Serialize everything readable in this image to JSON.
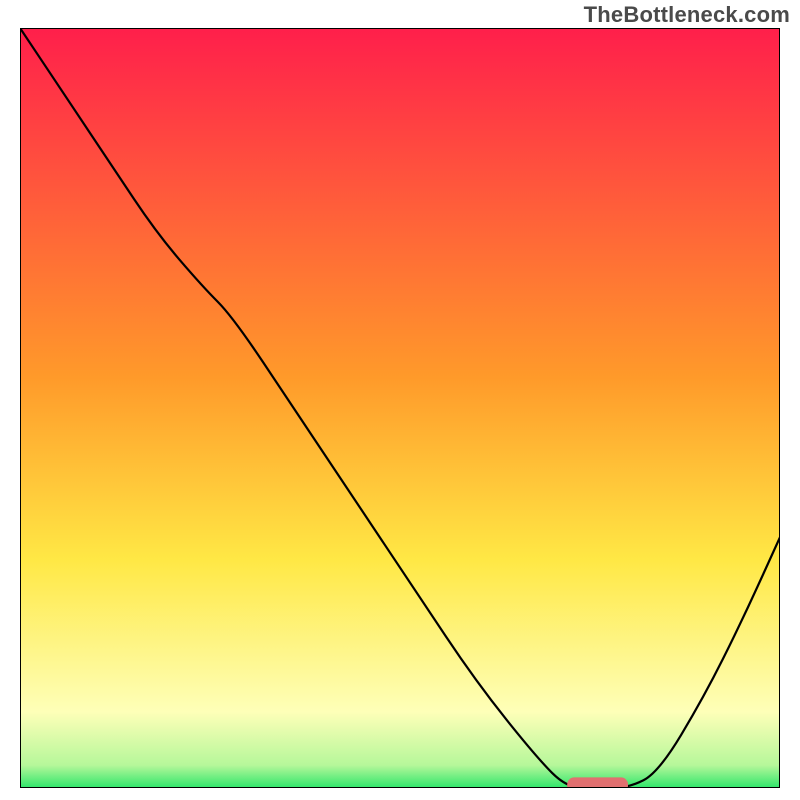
{
  "watermark": "TheBottleneck.com",
  "colors": {
    "gradient_top": "#ff1f4b",
    "gradient_mid1": "#ff9a2a",
    "gradient_mid2": "#ffe845",
    "gradient_pale": "#feffb8",
    "gradient_green": "#2ee66b",
    "curve": "#000000",
    "marker": "#e17070"
  },
  "chart_data": {
    "type": "line",
    "title": "",
    "xlabel": "",
    "ylabel": "",
    "xlim": [
      0,
      100
    ],
    "ylim": [
      0,
      100
    ],
    "grid": false,
    "series": [
      {
        "name": "bottleneck-curve",
        "x": [
          0,
          6,
          12,
          18,
          24,
          28,
          36,
          44,
          52,
          60,
          68,
          72,
          76,
          80,
          84,
          90,
          95,
          100
        ],
        "y": [
          100,
          91,
          82,
          73,
          66,
          62,
          50,
          38,
          26,
          14,
          4,
          0,
          0,
          0,
          2,
          12,
          22,
          33
        ]
      }
    ],
    "annotations": [
      {
        "name": "optimal-marker",
        "shape": "rounded-bar",
        "x_center": 76,
        "y": 0,
        "width": 8,
        "height": 2,
        "color": "#e17070"
      }
    ],
    "background": {
      "type": "vertical-gradient",
      "stops": [
        {
          "pos": 0.0,
          "color": "#ff1f4b"
        },
        {
          "pos": 0.46,
          "color": "#ff9a2a"
        },
        {
          "pos": 0.7,
          "color": "#ffe845"
        },
        {
          "pos": 0.9,
          "color": "#feffb8"
        },
        {
          "pos": 0.97,
          "color": "#b6f79a"
        },
        {
          "pos": 1.0,
          "color": "#2ee66b"
        }
      ]
    }
  }
}
